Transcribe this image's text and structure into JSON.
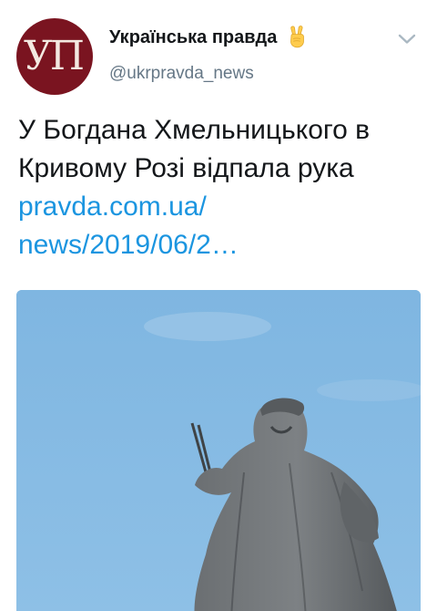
{
  "author": {
    "name": "Українська правда",
    "handle": "@ukrpravda_news",
    "avatar_text": "УП",
    "avatar_color": "#7a1420",
    "badge_icon": "victory-hand-emoji"
  },
  "tweet": {
    "text_line1": "У Богдана Хмельницького в",
    "text_line2": "Кривому Розі відпала рука",
    "link_line1": "pravda.com.ua/",
    "link_line2": "news/2019/06/2…"
  },
  "media": {
    "alt": "photo",
    "sky_color": "#7fb4df",
    "statue_color": "#5f6366"
  },
  "colors": {
    "link": "#1b95e0",
    "text": "#14171a",
    "secondary": "#657786"
  }
}
